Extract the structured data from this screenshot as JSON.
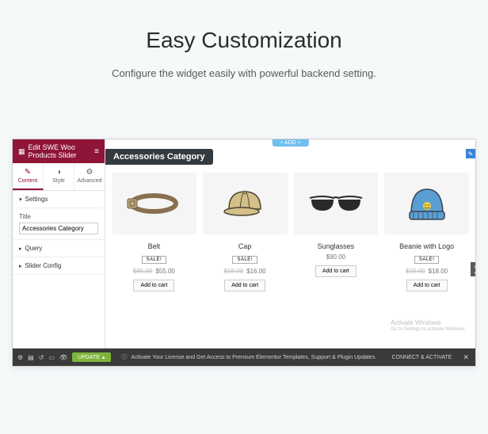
{
  "page": {
    "title": "Easy Customization",
    "subtitle": "Configure the widget easily with powerful backend setting."
  },
  "sidebar": {
    "header": "Edit SWE Woo Products Slider",
    "tabs": {
      "content": "Content",
      "style": "Style",
      "advanced": "Advanced"
    },
    "sections": {
      "settings": "Settings",
      "query": "Query",
      "slider": "Slider Config"
    },
    "title_field": {
      "label": "Title",
      "value": "Accessories Category"
    }
  },
  "canvas": {
    "add_label": "+ ADD +",
    "category_title": "Accessories Category"
  },
  "products": [
    {
      "name": "Belt",
      "sale": "SALE!",
      "old_price": "$65.00",
      "price": "$55.00",
      "cta": "Add to cart"
    },
    {
      "name": "Cap",
      "sale": "SALE!",
      "old_price": "$18.00",
      "price": "$16.00",
      "cta": "Add to cart"
    },
    {
      "name": "Sunglasses",
      "sale": null,
      "old_price": null,
      "price": "$90.00",
      "cta": "Add to cart"
    },
    {
      "name": "Beanie with Logo",
      "sale": "SALE!",
      "old_price": "$20.00",
      "price": "$18.00",
      "cta": "Add to cart"
    }
  ],
  "watermark": {
    "line1": "Activate Windows",
    "line2": "Go to Settings to activate Windows."
  },
  "bottombar": {
    "update": "UPDATE",
    "msg": "Activate Your License and Get Access to Premium Elementor Templates, Support & Plugin Updates.",
    "connect": "CONNECT & ACTIVATE"
  }
}
